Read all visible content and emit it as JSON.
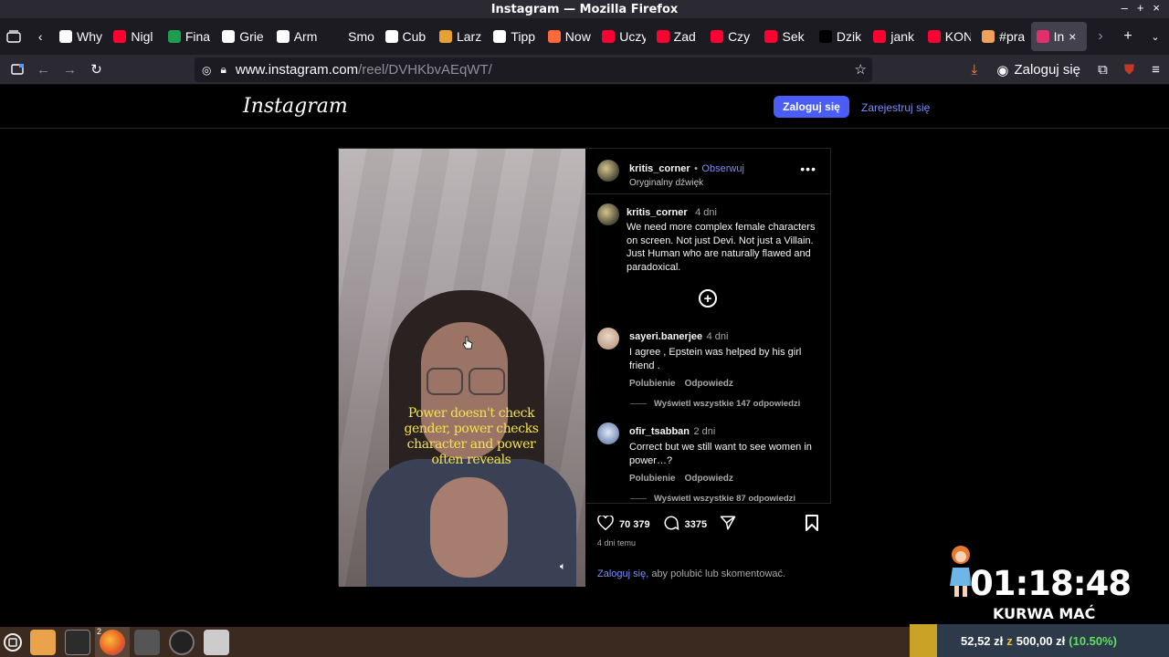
{
  "window": {
    "title": "Instagram — Mozilla Firefox"
  },
  "tabs": [
    {
      "label": "Why",
      "color": "#ffffff"
    },
    {
      "label": "Nigl",
      "color": "#ff0033"
    },
    {
      "label": "Fina",
      "color": "#1f9d4e"
    },
    {
      "label": "Grie",
      "color": "#ffffff"
    },
    {
      "label": "Arm",
      "color": "#ffffff"
    },
    {
      "label": "Smoke",
      "color": "#1c1b22"
    },
    {
      "label": "Cub",
      "color": "#ffffff"
    },
    {
      "label": "Larz",
      "color": "#e6a135"
    },
    {
      "label": "Tipp",
      "color": "#ffffff"
    },
    {
      "label": "Now",
      "color": "#ff6a3d"
    },
    {
      "label": "Uczy",
      "color": "#ff0033"
    },
    {
      "label": "Zad",
      "color": "#ff0033"
    },
    {
      "label": "Czy",
      "color": "#ff0033"
    },
    {
      "label": "Sek",
      "color": "#ff0033"
    },
    {
      "label": "Dzik",
      "color": "#000000"
    },
    {
      "label": "jank",
      "color": "#ff0033"
    },
    {
      "label": "KON",
      "color": "#ff0033"
    },
    {
      "label": "#pra",
      "color": "#f0a15a"
    },
    {
      "label": "In",
      "color": "#e1306c",
      "active": true
    }
  ],
  "nav": {
    "url_host": "www.instagram.com",
    "url_path": "/reel/DVHKbvAEqWT/",
    "login_label": "Zaloguj się"
  },
  "ig": {
    "logo": "Instagram",
    "login_btn": "Zaloguj się",
    "register_link": "Zarejestruj się"
  },
  "post": {
    "username": "kritis_corner",
    "separator": "•",
    "follow": "Obserwuj",
    "audio": "Oryginalny dźwięk",
    "caption_overlay": "Power doesn't check gender, power checks character and power often reveals",
    "caption": {
      "username": "kritis_corner",
      "time": "4 dni",
      "text": "We need more complex female characters on screen. Not just Devi. Not just a Villain. Just Human who are naturally flawed and paradoxical."
    },
    "comments": [
      {
        "username": "sayeri.banerjee",
        "time": "4 dni",
        "text": "I agree , Epstein was helped by his girl friend .",
        "like_label": "Polubienie",
        "reply_label": "Odpowiedz",
        "view_replies": "Wyświetl wszystkie 147 odpowiedzi"
      },
      {
        "username": "ofir_tsabban",
        "time": "2 dni",
        "text": "Correct but we still want to see women in power…?",
        "like_label": "Polubienie",
        "reply_label": "Odpowiedz",
        "view_replies": "Wyświetl wszystkie 87 odpowiedzi"
      }
    ],
    "likes": "70 379",
    "comments_count": "3375",
    "date": "4 dni temu",
    "login_link": "Zaloguj się,",
    "login_rest": " aby polubić lub skomentować."
  },
  "overlay": {
    "timer": "01:18:48",
    "caption": "KURWA MAĆ",
    "donation_amount": "52,52 zł",
    "donation_sep": "z",
    "donation_goal": "500,00 zł",
    "donation_pct": "(10.50%)"
  },
  "taskbar": {
    "firefox_badge": "2"
  }
}
